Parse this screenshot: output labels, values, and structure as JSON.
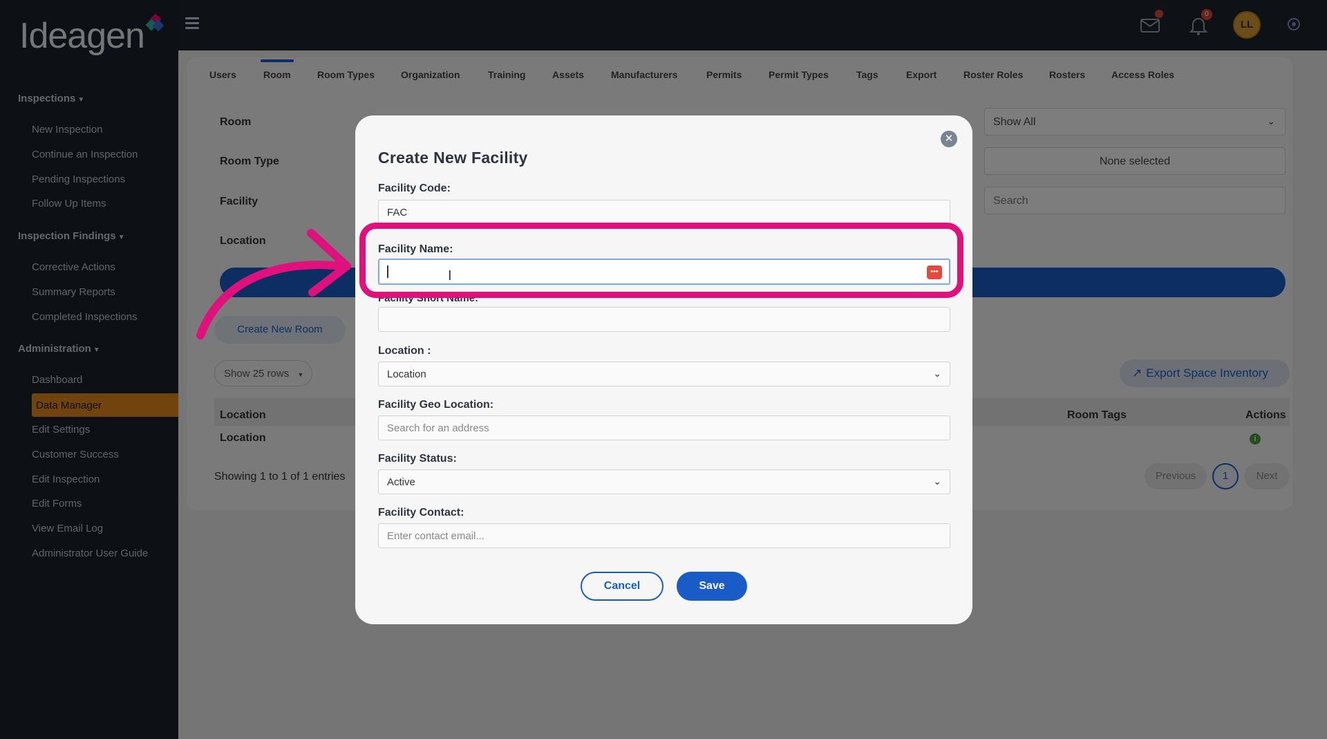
{
  "brand": {
    "logo_text": "Ideagen"
  },
  "sidebar": {
    "sections": [
      {
        "label": "Inspections",
        "items": [
          "New Inspection",
          "Continue an Inspection",
          "Pending Inspections",
          "Follow Up Items"
        ]
      },
      {
        "label": "Inspection Findings",
        "items": [
          "Corrective Actions",
          "Summary Reports",
          "Completed Inspections"
        ]
      },
      {
        "label": "Administration",
        "items": [
          "Dashboard",
          "Data Manager",
          "Edit Settings",
          "Customer Success",
          "Edit Inspection",
          "Edit Forms",
          "View Email Log",
          "Administrator User Guide"
        ]
      }
    ],
    "active_item": "Data Manager"
  },
  "topbar": {
    "mail_badge": "",
    "notification_badge": "0",
    "avatar_initials": "LL"
  },
  "tabs": [
    "Users",
    "Room",
    "Room Types",
    "Organization",
    "Training",
    "Assets",
    "Manufacturers",
    "Permits",
    "Permit Types",
    "Tags",
    "Export",
    "Roster Roles",
    "Rosters",
    "Access Roles"
  ],
  "active_tab": "Room",
  "filters": {
    "labels": [
      "Room",
      "Room Type",
      "Facility",
      "Location"
    ],
    "right_values": [
      "Show All",
      "None selected"
    ],
    "search_placeholder": "Search"
  },
  "actions": {
    "create_room": "Create New Room",
    "rows_select": "Show 25 rows",
    "export": "Export Space Inventory"
  },
  "table": {
    "headers": [
      "Location",
      "Room Tags",
      "Actions"
    ],
    "rows": [
      [
        "Location"
      ]
    ],
    "showing": "Showing 1 to 1 of 1 entries"
  },
  "pagination": {
    "previous": "Previous",
    "page": "1",
    "next": "Next"
  },
  "modal": {
    "title": "Create New Facility",
    "fields": {
      "code_label": "Facility Code:",
      "code_value": "FAC",
      "name_label": "Facility Name:",
      "name_value": "",
      "short_name_label": "Facility Short Name:",
      "location_label": "Location :",
      "location_value": "Location",
      "geo_label": "Facility Geo Location:",
      "geo_placeholder": "Search for an address",
      "status_label": "Facility Status:",
      "status_value": "Active",
      "contact_label": "Facility Contact:",
      "contact_placeholder": "Enter contact email..."
    },
    "cancel": "Cancel",
    "save": "Save"
  },
  "colors": {
    "highlight": "#e0117c",
    "primary": "#1a5cc7",
    "active_nav": "#e3891d",
    "sidebar_bg": "#1a2028"
  }
}
